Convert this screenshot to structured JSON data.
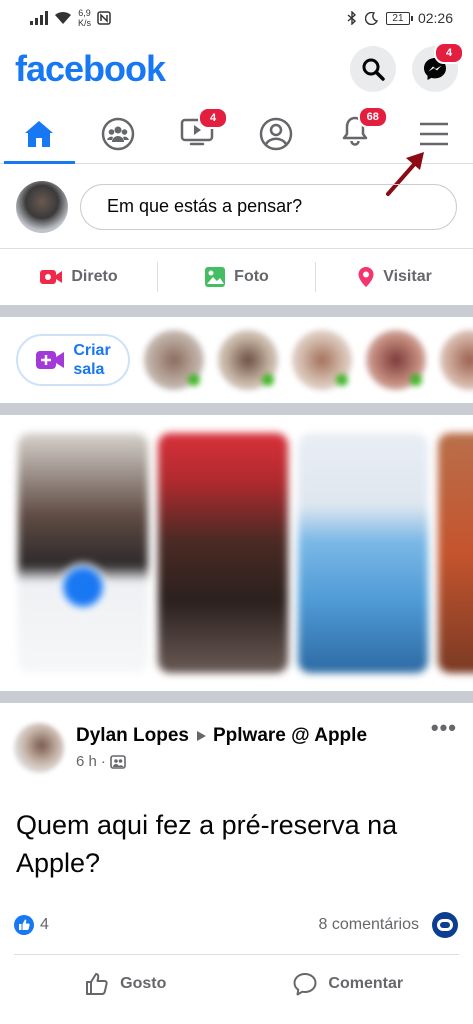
{
  "status_bar": {
    "speed_value": "6,9",
    "speed_unit": "K/s",
    "battery": "21",
    "time": "02:26"
  },
  "header": {
    "logo": "facebook",
    "messenger_badge": "4"
  },
  "tabs": {
    "watch_badge": "4",
    "notifications_badge": "68"
  },
  "composer": {
    "placeholder": "Em que estás a pensar?"
  },
  "actions": {
    "live_label": "Direto",
    "photo_label": "Foto",
    "checkin_label": "Visitar"
  },
  "rooms": {
    "create_label_line1": "Criar",
    "create_label_line2": "sala"
  },
  "post": {
    "author": "Dylan Lopes",
    "group": "Pplware @ Apple",
    "time": "6 h",
    "text": "Quem aqui fez a pré-reserva na Apple?",
    "likes": "4",
    "comments": "8 comentários",
    "like_label": "Gosto",
    "comment_label": "Comentar"
  },
  "colors": {
    "brand": "#1877f2",
    "badge": "#e41e3f",
    "annotation_arrow": "#8b0a14"
  }
}
